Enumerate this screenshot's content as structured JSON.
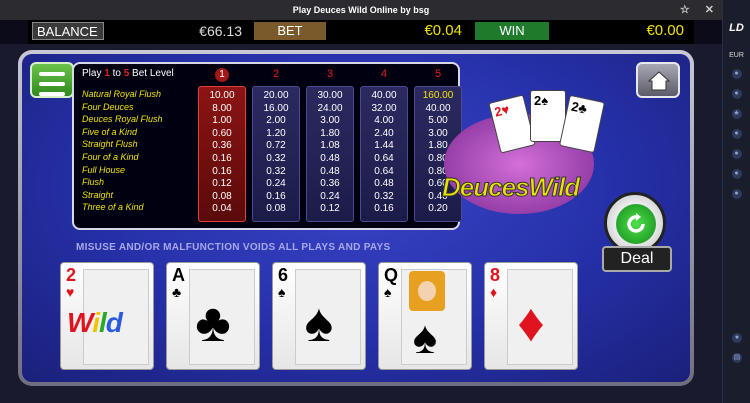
{
  "window": {
    "title": "Play Deuces Wild Online by bsg"
  },
  "sidebar": {
    "logo": "LD",
    "currency": "EUR"
  },
  "topbar": {
    "balance_label": "BALANCE",
    "balance_value": "€66.13",
    "bet_label": "BET",
    "bet_value": "€0.04",
    "win_label": "WIN",
    "win_value": "€0.00"
  },
  "paytable": {
    "header_play": "Play",
    "header_from": "1",
    "header_to_word": "to",
    "header_to": "5",
    "header_bet_level": "Bet Level",
    "columns": [
      "1",
      "2",
      "3",
      "4",
      "5"
    ],
    "selected_column": 1,
    "hands": [
      {
        "name": "Natural Royal Flush",
        "pays": [
          "10.00",
          "20.00",
          "30.00",
          "40.00",
          "160.00"
        ]
      },
      {
        "name": "Four Deuces",
        "pays": [
          "8.00",
          "16.00",
          "24.00",
          "32.00",
          "40.00"
        ]
      },
      {
        "name": "Deuces Royal Flush",
        "pays": [
          "1.00",
          "2.00",
          "3.00",
          "4.00",
          "5.00"
        ]
      },
      {
        "name": "Five of a Kind",
        "pays": [
          "0.60",
          "1.20",
          "1.80",
          "2.40",
          "3.00"
        ]
      },
      {
        "name": "Straight Flush",
        "pays": [
          "0.36",
          "0.72",
          "1.08",
          "1.44",
          "1.80"
        ]
      },
      {
        "name": "Four of a Kind",
        "pays": [
          "0.16",
          "0.32",
          "0.48",
          "0.64",
          "0.80"
        ]
      },
      {
        "name": "Full House",
        "pays": [
          "0.16",
          "0.32",
          "0.48",
          "0.64",
          "0.80"
        ]
      },
      {
        "name": "Flush",
        "pays": [
          "0.12",
          "0.24",
          "0.36",
          "0.48",
          "0.60"
        ]
      },
      {
        "name": "Straight",
        "pays": [
          "0.08",
          "0.16",
          "0.24",
          "0.32",
          "0.40"
        ]
      },
      {
        "name": "Three of a Kind",
        "pays": [
          "0.04",
          "0.08",
          "0.12",
          "0.16",
          "0.20"
        ]
      }
    ]
  },
  "logo": {
    "text": "DeucesWild",
    "cards": [
      "2",
      "2",
      "2"
    ]
  },
  "warning": "MISUSE AND/OR MALFUNCTION VOIDS ALL PLAYS AND PAYS",
  "deal_label": "Deal",
  "cards": [
    {
      "rank": "2",
      "suit": "♥",
      "color": "red",
      "wild": true,
      "wild_text": "Wild"
    },
    {
      "rank": "A",
      "suit": "♣",
      "color": "black",
      "wild": false
    },
    {
      "rank": "6",
      "suit": "♠",
      "color": "black",
      "wild": false
    },
    {
      "rank": "Q",
      "suit": "♠",
      "color": "black",
      "wild": false,
      "face": true
    },
    {
      "rank": "8",
      "suit": "♦",
      "color": "red",
      "wild": false
    }
  ],
  "colors": {
    "felt": "#2530a8",
    "paytable_text": "#f2e300",
    "selected_column": "#8c1414"
  },
  "icons": [
    "menu-icon",
    "home-icon",
    "refresh-icon",
    "pin-icon",
    "close-icon"
  ]
}
